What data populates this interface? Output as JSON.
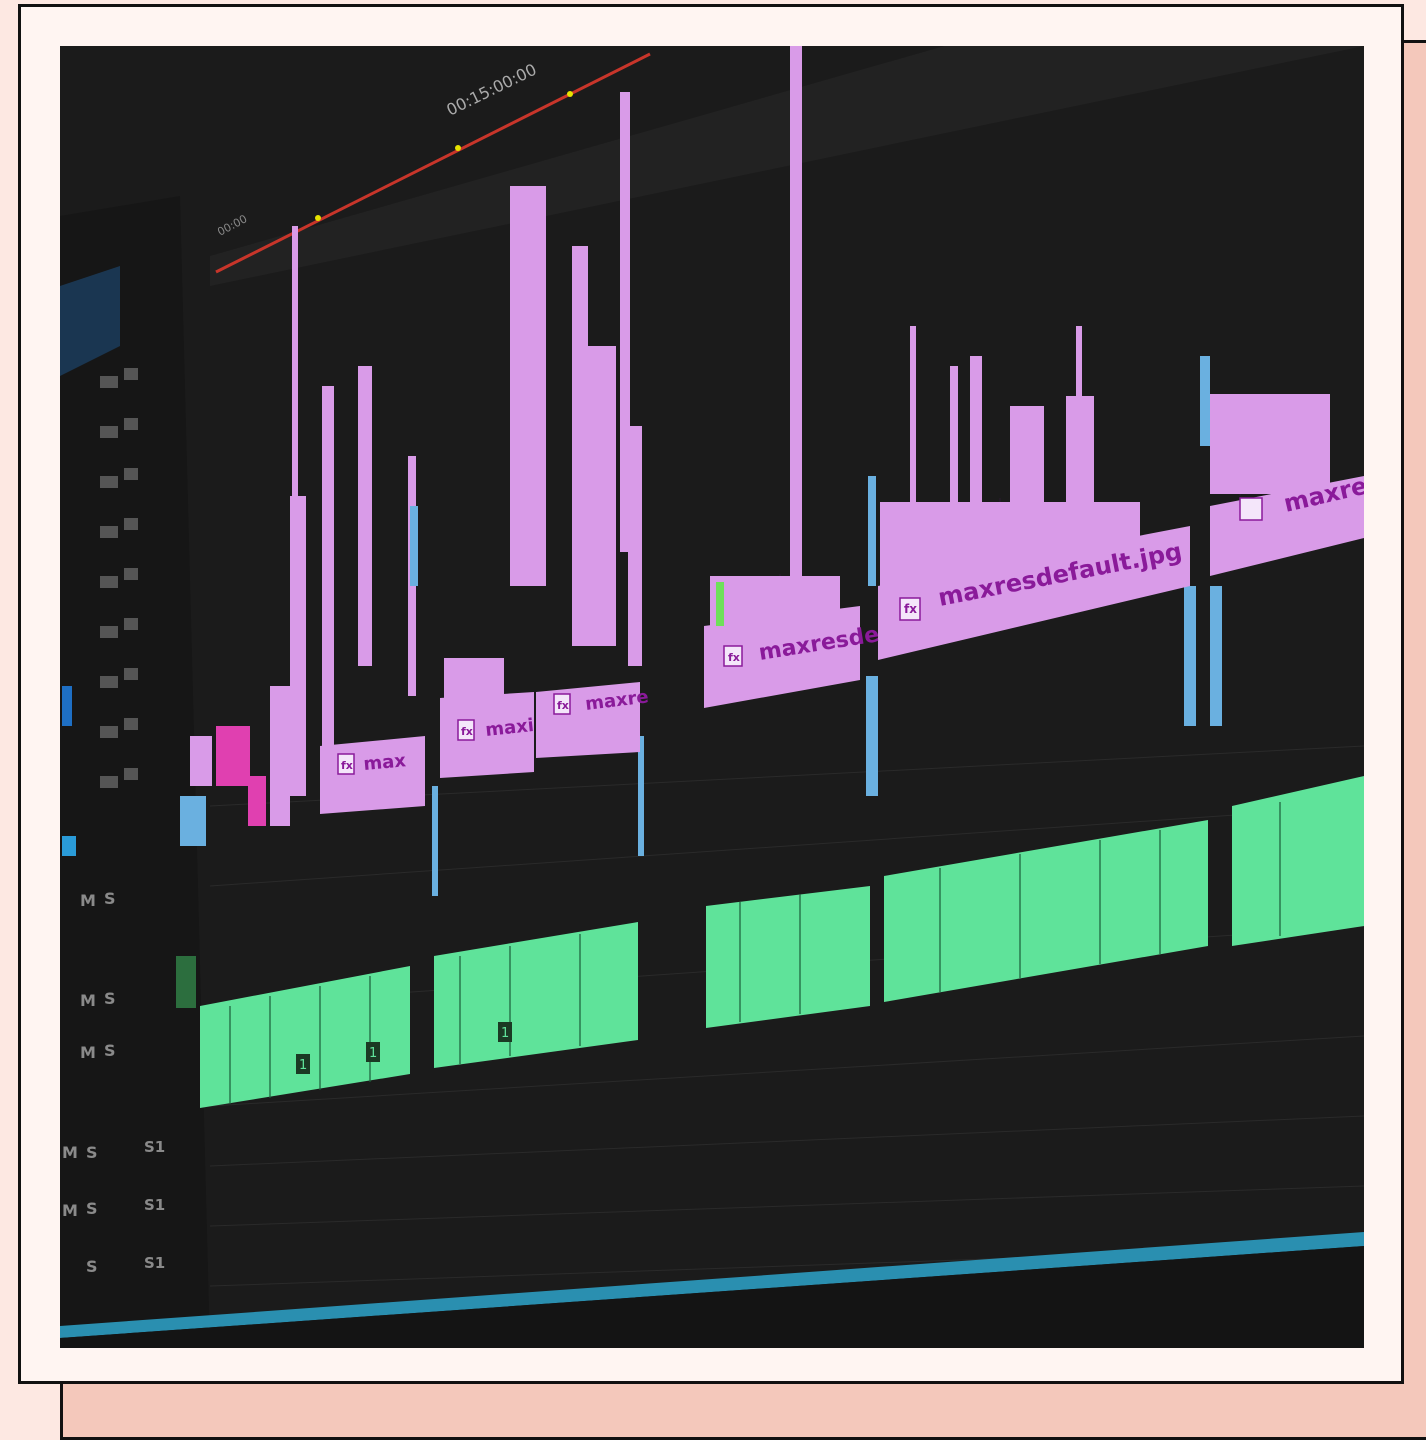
{
  "photo": {
    "timecode": "00:15:00:00",
    "timecode_start": "00:00",
    "fx_badge": "fx",
    "clip_labels": [
      "max",
      "maxi",
      "maxre",
      "maxresde",
      "maxresdefault.jpg",
      "maxre"
    ],
    "audio_clip_markers": [
      "1",
      "1",
      "1"
    ],
    "track_header_letters": [
      "M",
      "S"
    ],
    "sync_labels": [
      "S1",
      "S1",
      "S1"
    ],
    "colors": {
      "background": "#1b1b1b",
      "video_clip": "#d99be8",
      "audio_clip": "#5fe39a",
      "playhead_bar": "#c8352a",
      "accent_blue": "#6ab0e0",
      "frame_outer": "#f4c8bb",
      "frame_inner": "#fff5f2"
    }
  }
}
